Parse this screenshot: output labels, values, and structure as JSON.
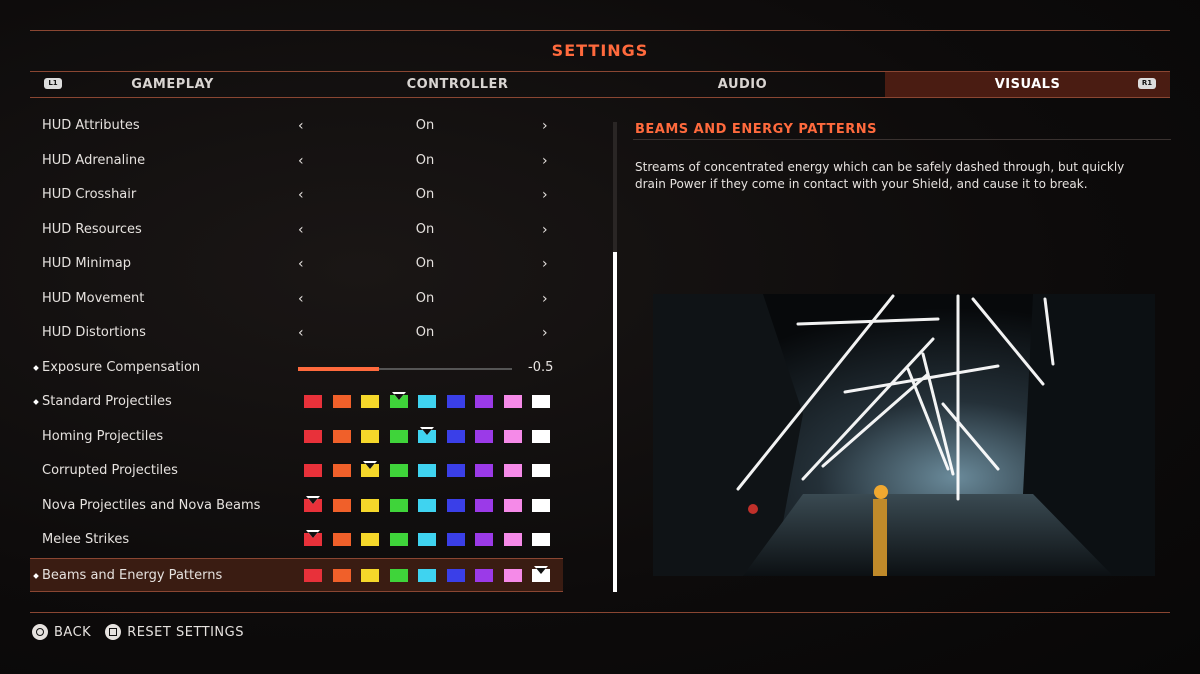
{
  "header": {
    "title": "SETTINGS"
  },
  "bumpers": {
    "left": "L1",
    "right": "R1"
  },
  "tabs": [
    {
      "label": "GAMEPLAY",
      "active": false
    },
    {
      "label": "CONTROLLER",
      "active": false
    },
    {
      "label": "AUDIO",
      "active": false
    },
    {
      "label": "VISUALS",
      "active": true
    }
  ],
  "colors": {
    "accent": "#ff6a3d",
    "swatches": [
      "#e8313a",
      "#f0602a",
      "#f5d72a",
      "#3fd43a",
      "#3fd3f0",
      "#3a3fe8",
      "#9b3ae8",
      "#f58ae8",
      "#ffffff"
    ]
  },
  "settings": {
    "toggles": [
      {
        "label": "HUD Attributes",
        "value": "On"
      },
      {
        "label": "HUD Adrenaline",
        "value": "On"
      },
      {
        "label": "HUD Crosshair",
        "value": "On"
      },
      {
        "label": "HUD Resources",
        "value": "On"
      },
      {
        "label": "HUD Minimap",
        "value": "On"
      },
      {
        "label": "HUD Movement",
        "value": "On"
      },
      {
        "label": "HUD Distortions",
        "value": "On"
      }
    ],
    "slider": {
      "label": "Exposure Compensation",
      "value": "-0.5",
      "fill_fraction": 0.38
    },
    "color_rows": [
      {
        "label": "Standard Projectiles",
        "selected_index": 3,
        "marked": true
      },
      {
        "label": "Homing Projectiles",
        "selected_index": 4,
        "marked": false
      },
      {
        "label": "Corrupted Projectiles",
        "selected_index": 2,
        "marked": false
      },
      {
        "label": "Nova Projectiles and Nova Beams",
        "selected_index": 0,
        "marked": false
      },
      {
        "label": "Melee Strikes",
        "selected_index": 0,
        "marked": false
      },
      {
        "label": "Beams and Energy Patterns",
        "selected_index": 8,
        "marked": true
      }
    ],
    "prev_icon": "chevron-left-icon",
    "next_icon": "chevron-right-icon"
  },
  "detail": {
    "title": "BEAMS AND ENERGY PATTERNS",
    "description": "Streams of concentrated energy which can be safely dashed through, but quickly drain Power if they come in contact with your Shield, and cause it to break."
  },
  "footer": {
    "back_label": "BACK",
    "reset_label": "RESET SETTINGS"
  }
}
